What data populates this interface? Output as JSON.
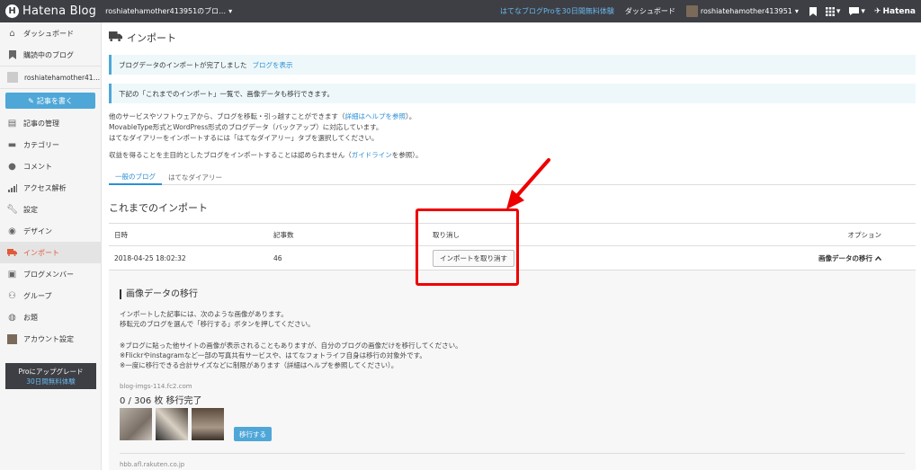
{
  "topbar": {
    "logo_mark": "H",
    "logo_text": "Hatena Blog",
    "blog_switch": "roshiatehamother413951のブロ…",
    "pro_trial": "はてなブログProを30日間無料体験",
    "dashboard": "ダッシュボード",
    "user": "roshiatehamother413951",
    "hatena": "Hatena"
  },
  "sidebar": {
    "items": [
      {
        "label": "ダッシュボード",
        "icon": "home-icon"
      },
      {
        "label": "購読中のブログ",
        "icon": "bookmark-icon"
      }
    ],
    "blog_name": "roshiatehamother41…",
    "write_label": "記事を書く",
    "menu": [
      {
        "label": "記事の管理",
        "icon": "document-icon"
      },
      {
        "label": "カテゴリー",
        "icon": "folder-icon"
      },
      {
        "label": "コメント",
        "icon": "comment-icon"
      },
      {
        "label": "アクセス解析",
        "icon": "chart-icon"
      },
      {
        "label": "設定",
        "icon": "wrench-icon"
      },
      {
        "label": "デザイン",
        "icon": "palette-icon"
      },
      {
        "label": "インポート",
        "icon": "truck-icon"
      },
      {
        "label": "ブログメンバー",
        "icon": "members-icon"
      },
      {
        "label": "グループ",
        "icon": "group-icon"
      },
      {
        "label": "お題",
        "icon": "topic-icon"
      },
      {
        "label": "アカウント設定",
        "icon": "account-icon"
      }
    ],
    "upgrade": {
      "title": "Proにアップグレード",
      "sub": "30日間無料体験"
    }
  },
  "main": {
    "title": "インポート",
    "notice1": {
      "text": "ブログデータのインポートが完了しました",
      "link": "ブログを表示"
    },
    "notice2": "下記の「これまでのインポート」一覧で、画像データも移行できます。",
    "intro": {
      "line1_a": "他のサービスやソフトウェアから、ブログを移転・引っ越すことができます（",
      "line1_link": "詳細はヘルプを参照",
      "line1_b": "）。",
      "line2": "MovableType形式とWordPress形式のブログデータ（バックアップ）に対応しています。",
      "line3": "はてなダイアリーをインポートするには「はてなダイアリー」タブを選択してください。"
    },
    "revenue": {
      "a": "収益を得ることを主目的としたブログをインポートすることは認められません（",
      "link": "ガイドライン",
      "b": "を参照）。"
    },
    "tabs": [
      "一般のブログ",
      "はてなダイアリー"
    ],
    "section_title": "これまでのインポート",
    "table": {
      "headers": {
        "date": "日時",
        "count": "記事数",
        "cancel": "取り消し",
        "option": "オプション"
      },
      "row": {
        "date": "2018-04-25 18:02:32",
        "count": "46",
        "cancel_button": "インポートを取り消す",
        "option_link": "画像データの移行"
      }
    },
    "migration": {
      "title": "画像データの移行",
      "p1": "インポートした記事には、次のような画像があります。",
      "p2": "移転元のブログを選んで「移行する」ボタンを押してください。",
      "n1": "※ブログに貼った他サイトの画像が表示されることもありますが、自分のブログの画像だけを移行してください。",
      "n2": "※Flickrやinstagramなど一部の写真共有サービスや、はてなフォトライフ自身は移行の対象外です。",
      "n3": "※一度に移行できる合計サイズなどに制限があります（詳細はヘルプを参照してください）。",
      "source1": "blog-imgs-114.fc2.com",
      "progress": "0 / 306 枚 移行完了",
      "move_button": "移行する",
      "source2": "hbb.afl.rakuten.co.jp"
    }
  },
  "colors": {
    "accent": "#4fa7d8",
    "highlight": "#e00000",
    "active": "#e05a3a"
  }
}
